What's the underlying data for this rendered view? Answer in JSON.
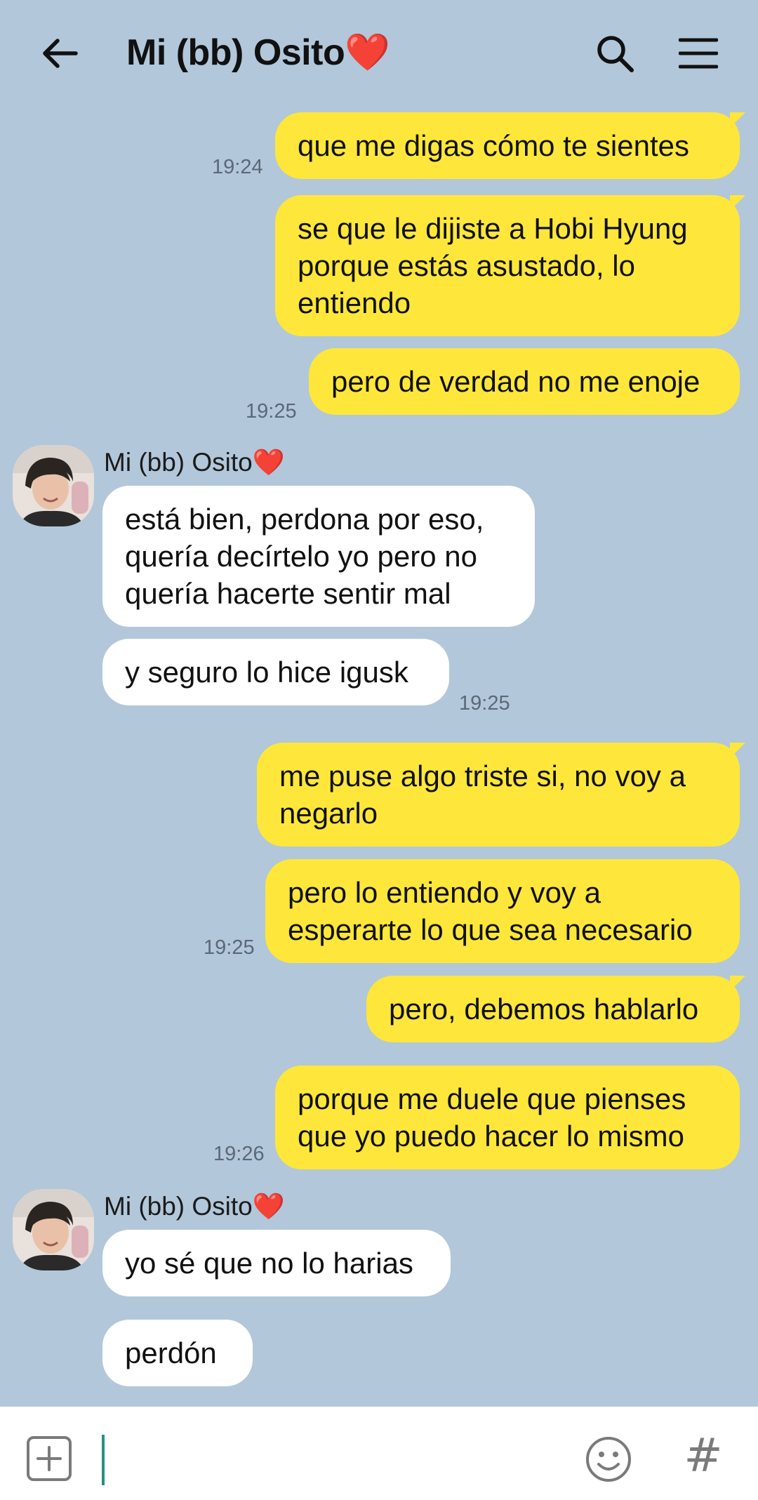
{
  "header": {
    "title": "Mi (bb) Osito❤️",
    "back_icon": "arrow-left-icon",
    "search_icon": "search-icon",
    "menu_icon": "hamburger-menu-icon"
  },
  "messages": [
    {
      "from": "me",
      "lines": [
        "que me digas cómo te sientes"
      ],
      "time": "19:24"
    },
    {
      "from": "me",
      "lines": [
        "se que le dijiste a Hobi Hyung",
        "porque estás asustado, lo",
        "entiendo"
      ]
    },
    {
      "from": "me",
      "lines": [
        "pero de verdad no me enoje"
      ],
      "time": "19:25"
    },
    {
      "from": "them",
      "sender": "Mi (bb) Osito❤️",
      "lines": [
        "está bien, perdona por eso,",
        "quería decírtelo yo pero no",
        "quería hacerte sentir mal"
      ]
    },
    {
      "from": "them",
      "lines": [
        "y seguro lo hice igusk"
      ],
      "time": "19:25"
    },
    {
      "from": "me",
      "lines": [
        "me puse algo triste si, no voy a",
        "negarlo"
      ]
    },
    {
      "from": "me",
      "lines": [
        "pero lo entiendo y voy a",
        "esperarte lo que sea necesario"
      ],
      "time": "19:25"
    },
    {
      "from": "me",
      "lines": [
        "pero, debemos hablarlo"
      ]
    },
    {
      "from": "me",
      "lines": [
        "porque me duele que pienses",
        "que yo puedo hacer lo mismo"
      ],
      "time": "19:26"
    },
    {
      "from": "them",
      "sender": "Mi (bb) Osito❤️",
      "lines": [
        "yo sé que no lo harias"
      ]
    },
    {
      "from": "them",
      "lines": [
        "perdón"
      ]
    }
  ],
  "input": {
    "placeholder": "",
    "value": "",
    "attach_icon": "plus-square-icon",
    "emoji_icon": "smiley-icon",
    "hashtag_label": "#"
  },
  "colors": {
    "background": "#b2c7da",
    "my_bubble": "#fee73a",
    "their_bubble": "#ffffff",
    "cursor": "#2a8f7e"
  }
}
